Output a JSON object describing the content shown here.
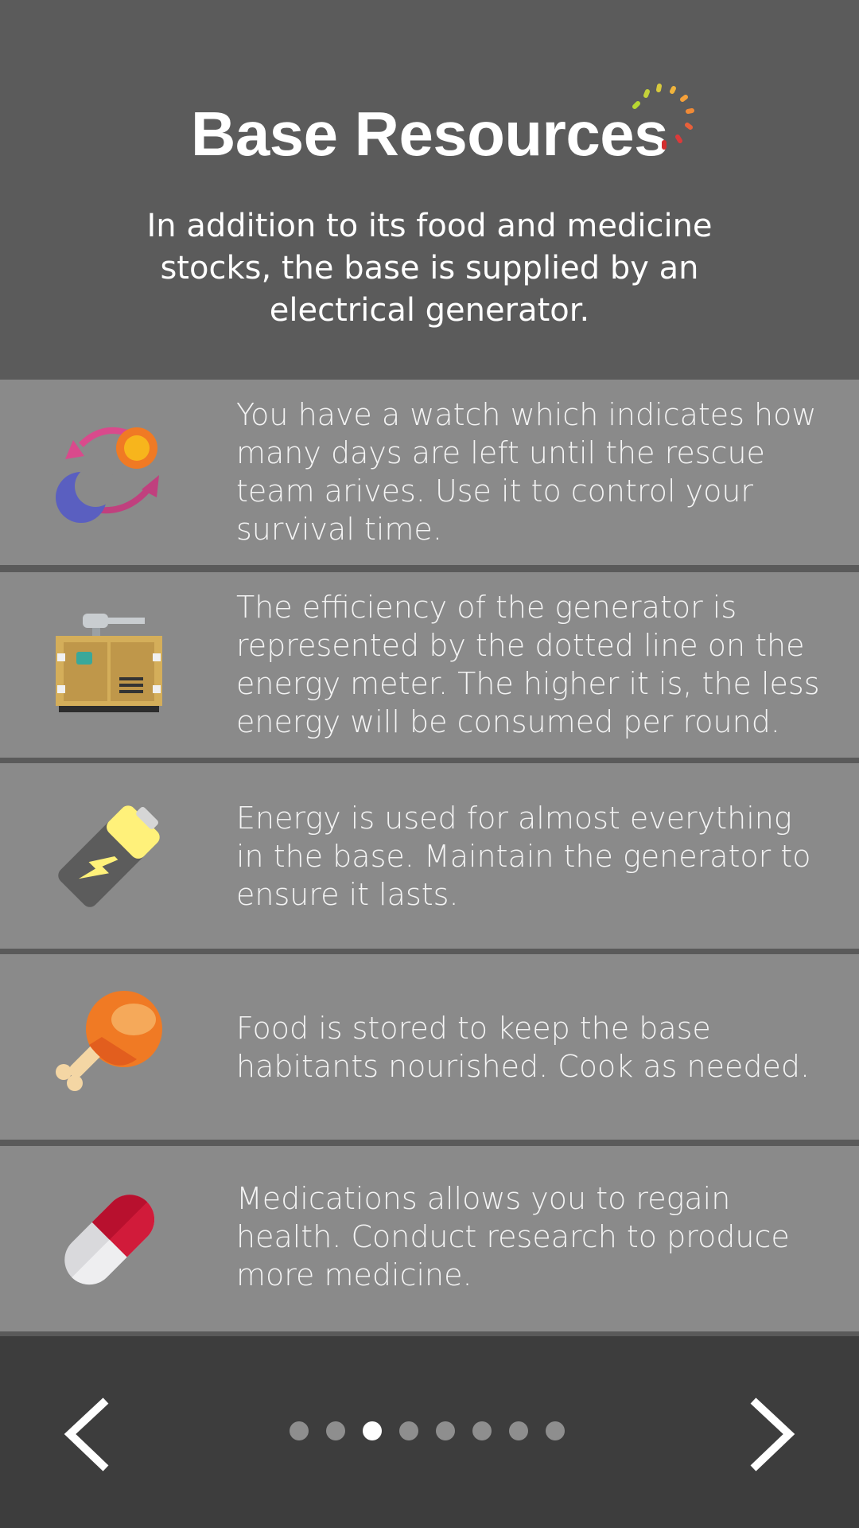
{
  "header": {
    "title": "Base Resources",
    "subtitle": "In addition to its food and medicine stocks, the base is supplied by an electrical generator."
  },
  "rows": [
    {
      "icon": "day-night-cycle-icon",
      "text": "You have a watch which indicates how many days are left until the rescue team arives. Use it to control your survival time."
    },
    {
      "icon": "generator-icon",
      "text": "The efficiency of the generator is represented by the dotted line on the energy meter. The higher it is, the less energy will be consumed per round."
    },
    {
      "icon": "battery-icon",
      "text": "Energy is used for almost everything in the base. Maintain the generator to ensure it lasts."
    },
    {
      "icon": "chicken-leg-icon",
      "text": "Food is stored to keep the base habitants nourished. Cook as needed."
    },
    {
      "icon": "pill-icon",
      "text": "Medications allows you to regain health. Conduct research to produce more medicine."
    }
  ],
  "pagination": {
    "total": 8,
    "current": 3
  },
  "colors": {
    "header_bg": "#5b5b5b",
    "row_bg": "#8a8a8a",
    "footer_bg": "#3d3d3d",
    "dot_inactive": "#8e8e8e",
    "dot_active": "#ffffff"
  }
}
